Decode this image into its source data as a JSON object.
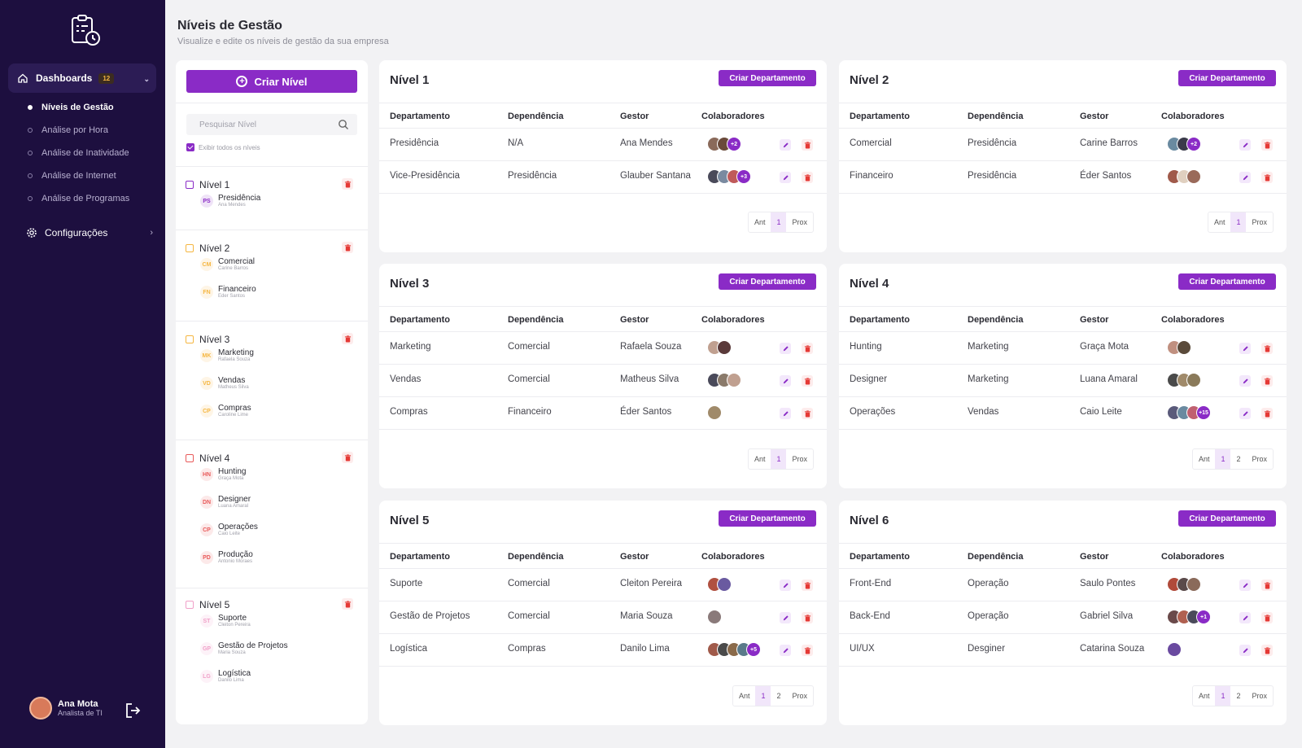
{
  "header": {
    "title": "Níveis de Gestão",
    "subtitle": "Visualize e edite os níveis de gestão da sua empresa"
  },
  "sidebar": {
    "dashboards_label": "Dashboards",
    "dashboards_badge": "12",
    "items": [
      {
        "label": "Níveis de Gestão"
      },
      {
        "label": "Análise por Hora"
      },
      {
        "label": "Análise de Inatividade"
      },
      {
        "label": "Análise de Internet"
      },
      {
        "label": "Análise de Programas"
      }
    ],
    "config_label": "Configurações",
    "user": {
      "name": "Ana Mota",
      "role": "Analista de TI"
    }
  },
  "left_panel": {
    "create_label": "Criar Nível",
    "search_placeholder": "Pesquisar Nível",
    "show_all_label": "Exibir todos os níveis",
    "levels": [
      {
        "name": "Nível 1",
        "color": "#8a2bc6",
        "deps": [
          {
            "abbr": "PS",
            "name": "Presidência",
            "manager": "Ana Mendes"
          }
        ]
      },
      {
        "name": "Nível 2",
        "color": "#f5b640",
        "deps": [
          {
            "abbr": "CM",
            "name": "Comercial",
            "manager": "Carine Barros"
          },
          {
            "abbr": "FN",
            "name": "Financeiro",
            "manager": "Eder Santos"
          }
        ]
      },
      {
        "name": "Nível 3",
        "color": "#f5b640",
        "deps": [
          {
            "abbr": "MK",
            "name": "Marketing",
            "manager": "Rafaela Souza"
          },
          {
            "abbr": "VD",
            "name": "Vendas",
            "manager": "Matheus Silva"
          },
          {
            "abbr": "CP",
            "name": "Compras",
            "manager": "Caroline Lime"
          }
        ]
      },
      {
        "name": "Nível 4",
        "color": "#e85a5a",
        "deps": [
          {
            "abbr": "HN",
            "name": "Hunting",
            "manager": "Graça Mota"
          },
          {
            "abbr": "DN",
            "name": "Designer",
            "manager": "Luana Amaral"
          },
          {
            "abbr": "CP",
            "name": "Operações",
            "manager": "Caio Leite"
          },
          {
            "abbr": "PD",
            "name": "Produção",
            "manager": "Antonio Moraes"
          }
        ]
      },
      {
        "name": "Nível 5",
        "color": "#f0a0c8",
        "deps": [
          {
            "abbr": "ST",
            "name": "Suporte",
            "manager": "Cleiton Pereira"
          },
          {
            "abbr": "GP",
            "name": "Gestão de Projetos",
            "manager": "Maria Souza"
          },
          {
            "abbr": "LG",
            "name": "Logística",
            "manager": "Danilo Lima"
          }
        ]
      }
    ]
  },
  "table_headers": {
    "dep": "Departamento",
    "depend": "Dependência",
    "manager": "Gestor",
    "collab": "Colaboradores"
  },
  "create_dep_label": "Criar Departamento",
  "pager": {
    "prev": "Ant",
    "next": "Prox"
  },
  "cards": [
    {
      "title": "Nível 1",
      "rows": [
        {
          "dep": "Presidência",
          "depend": "N/A",
          "manager": "Ana Mendes",
          "avatars": [
            "#8a6a5a",
            "#6a4a3a"
          ],
          "more": "+2"
        },
        {
          "dep": "Vice-Presidência",
          "depend": "Presidência",
          "manager": "Glauber Santana",
          "avatars": [
            "#4a4a5a",
            "#7a8aa0",
            "#c05a5a"
          ],
          "more": "+3"
        }
      ],
      "pages": [
        "1"
      ]
    },
    {
      "title": "Nível 2",
      "rows": [
        {
          "dep": "Comercial",
          "depend": "Presidência",
          "manager": "Carine Barros",
          "avatars": [
            "#6a8aa0",
            "#3a3a4a"
          ],
          "more": "+2"
        },
        {
          "dep": "Financeiro",
          "depend": "Presidência",
          "manager": "Éder Santos",
          "avatars": [
            "#a05a4a",
            "#e0d0c0",
            "#9a6a5a"
          ],
          "more": ""
        }
      ],
      "pages": [
        "1"
      ]
    },
    {
      "title": "Nível 3",
      "rows": [
        {
          "dep": "Marketing",
          "depend": "Comercial",
          "manager": "Rafaela Souza",
          "avatars": [
            "#c0a090",
            "#5a3a3a"
          ],
          "more": ""
        },
        {
          "dep": "Vendas",
          "depend": "Comercial",
          "manager": "Matheus Silva",
          "avatars": [
            "#4a4a5a",
            "#8a7a6a",
            "#c0a090"
          ],
          "more": ""
        },
        {
          "dep": "Compras",
          "depend": "Financeiro",
          "manager": "Éder Santos",
          "avatars": [
            "#a08a6a"
          ],
          "more": ""
        }
      ],
      "pages": [
        "1"
      ]
    },
    {
      "title": "Nível 4",
      "rows": [
        {
          "dep": "Hunting",
          "depend": "Marketing",
          "manager": "Graça Mota",
          "avatars": [
            "#c09080",
            "#5a4a3a"
          ],
          "more": ""
        },
        {
          "dep": "Designer",
          "depend": "Marketing",
          "manager": "Luana Amaral",
          "avatars": [
            "#4a4a4a",
            "#a08a6a",
            "#8a7a5a"
          ],
          "more": ""
        },
        {
          "dep": "Operações",
          "depend": "Vendas",
          "manager": "Caio Leite",
          "avatars": [
            "#5a5a7a",
            "#6a8aa0",
            "#c06070"
          ],
          "more": "+15"
        }
      ],
      "pages": [
        "1",
        "2"
      ]
    },
    {
      "title": "Nível 5",
      "rows": [
        {
          "dep": "Suporte",
          "depend": "Comercial",
          "manager": "Cleiton Pereira",
          "avatars": [
            "#b05040",
            "#6a5aa0"
          ],
          "more": ""
        },
        {
          "dep": "Gestão de Projetos",
          "depend": "Comercial",
          "manager": "Maria Souza",
          "avatars": [
            "#8a7a7a"
          ],
          "more": ""
        },
        {
          "dep": "Logística",
          "depend": "Compras",
          "manager": "Danilo Lima",
          "avatars": [
            "#a05a4a",
            "#4a4a4a",
            "#8a6a4a",
            "#5a7a8a"
          ],
          "more": "+5"
        }
      ],
      "pages": [
        "1",
        "2"
      ]
    },
    {
      "title": "Nível 6",
      "rows": [
        {
          "dep": "Front-End",
          "depend": "Operação",
          "manager": "Saulo Pontes",
          "avatars": [
            "#b04a3a",
            "#5a4a4a",
            "#8a6a5a"
          ],
          "more": ""
        },
        {
          "dep": "Back-End",
          "depend": "Operação",
          "manager": "Gabriel Silva",
          "avatars": [
            "#6a4a4a",
            "#b06050",
            "#4a4a5a"
          ],
          "more": "+1"
        },
        {
          "dep": "UI/UX",
          "depend": "Desginer",
          "manager": "Catarina Souza",
          "avatars": [
            "#6a4aa0"
          ],
          "more": ""
        }
      ],
      "pages": [
        "1",
        "2"
      ]
    }
  ]
}
